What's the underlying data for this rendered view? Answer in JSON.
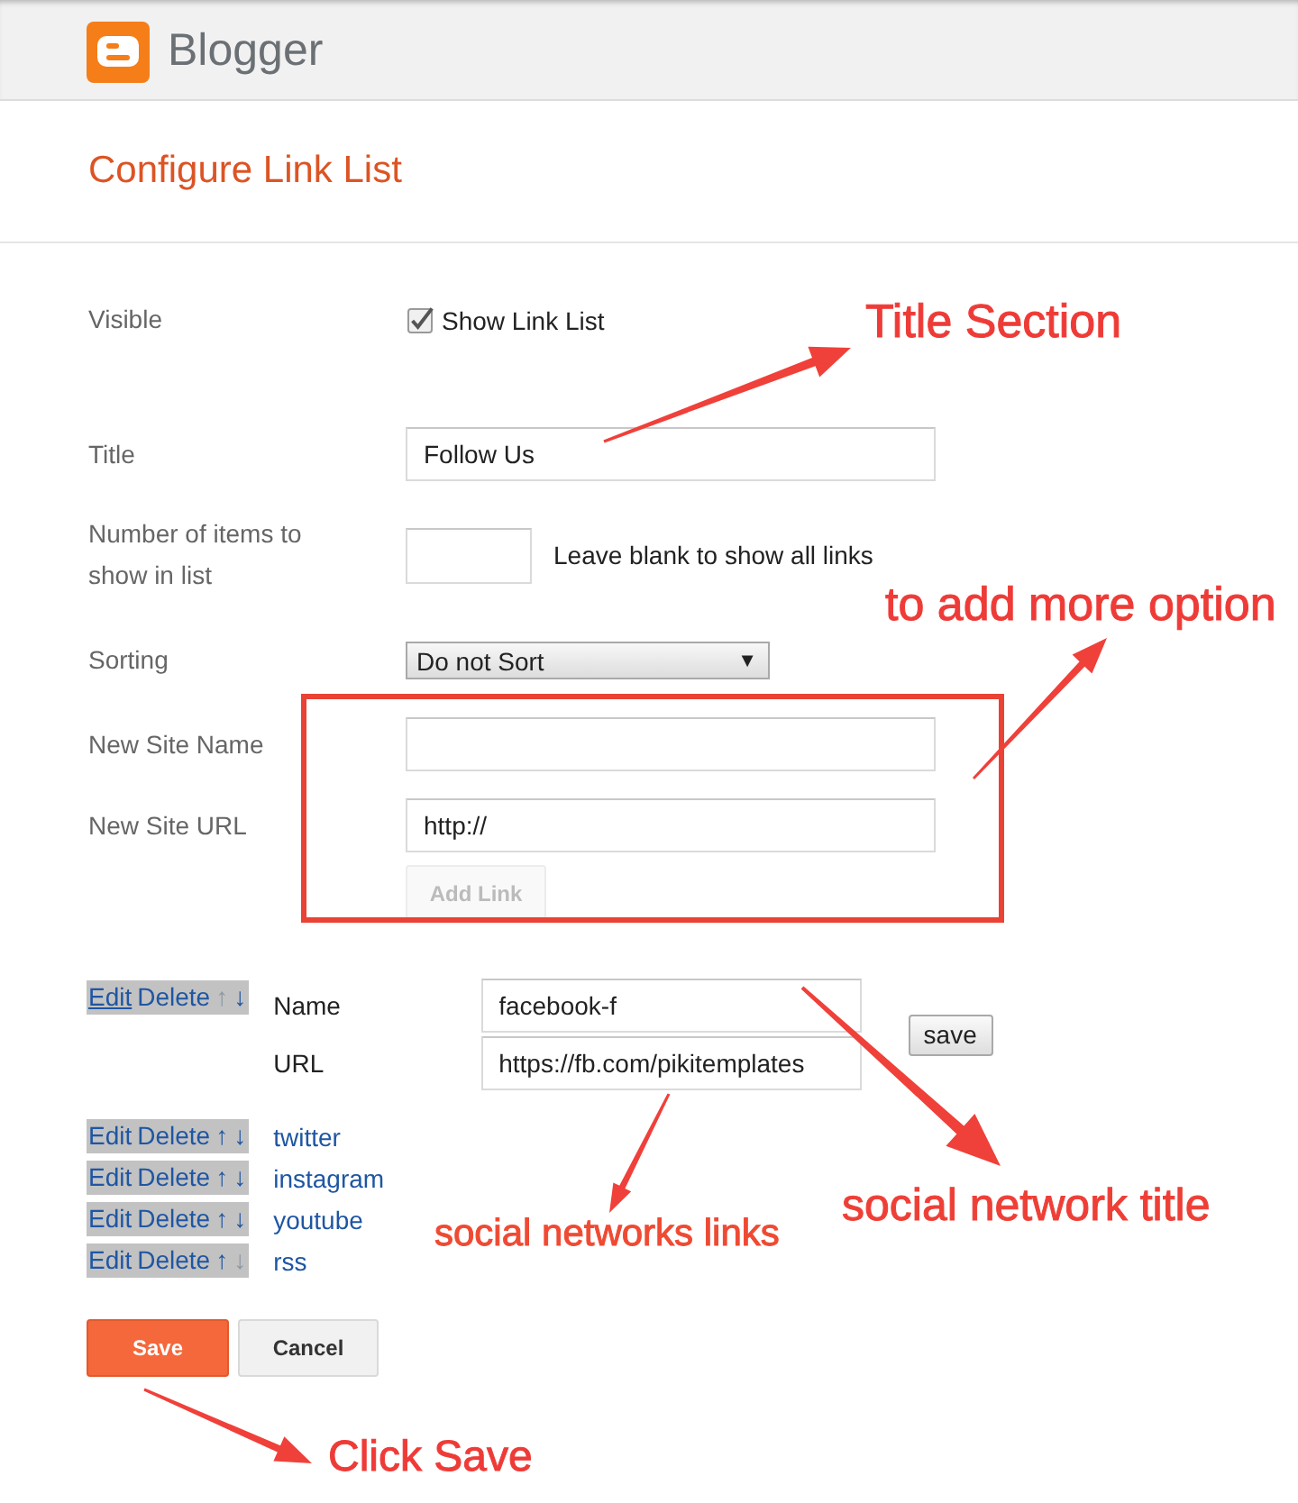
{
  "header": {
    "brand": "Blogger"
  },
  "page_title": "Configure Link List",
  "form": {
    "visible": {
      "label": "Visible",
      "option": "Show Link List",
      "checked": true
    },
    "title": {
      "label": "Title",
      "value": "Follow Us"
    },
    "items_count": {
      "label": "Number of items to show in list",
      "hint": "Leave blank to show all links"
    },
    "sorting": {
      "label": "Sorting",
      "value": "Do not Sort",
      "arrow": "▼"
    },
    "new_site_name": {
      "label": "New Site Name"
    },
    "new_site_url": {
      "label": "New Site URL",
      "value": "http://"
    },
    "add_link": {
      "label": "Add Link",
      "disabled": true
    }
  },
  "links": [
    {
      "edit": "Edit",
      "delete": "Delete",
      "up": "↑",
      "down": "↓",
      "up_disabled": true,
      "down_disabled": false,
      "expanded": true,
      "name_label": "Name",
      "name": "facebook-f",
      "url_label": "URL",
      "url": "https://fb.com/pikitemplates",
      "save": "save"
    },
    {
      "edit": "Edit",
      "delete": "Delete",
      "up": "↑",
      "down": "↓",
      "up_disabled": false,
      "down_disabled": false,
      "expanded": false,
      "name": "twitter"
    },
    {
      "edit": "Edit",
      "delete": "Delete",
      "up": "↑",
      "down": "↓",
      "up_disabled": false,
      "down_disabled": false,
      "expanded": false,
      "name": "instagram"
    },
    {
      "edit": "Edit",
      "delete": "Delete",
      "up": "↑",
      "down": "↓",
      "up_disabled": false,
      "down_disabled": false,
      "expanded": false,
      "name": "youtube"
    },
    {
      "edit": "Edit",
      "delete": "Delete",
      "up": "↑",
      "down": "↓",
      "up_disabled": false,
      "down_disabled": true,
      "expanded": false,
      "name": "rss"
    }
  ],
  "buttons": [
    {
      "label": "Save",
      "kind": "primary"
    },
    {
      "label": "Cancel",
      "kind": "secondary"
    }
  ],
  "annotations": [
    {
      "text": "Title Section"
    },
    {
      "text": "to add more option"
    },
    {
      "text": "social network title"
    },
    {
      "text": "social networks links"
    },
    {
      "text": "Click Save"
    }
  ]
}
